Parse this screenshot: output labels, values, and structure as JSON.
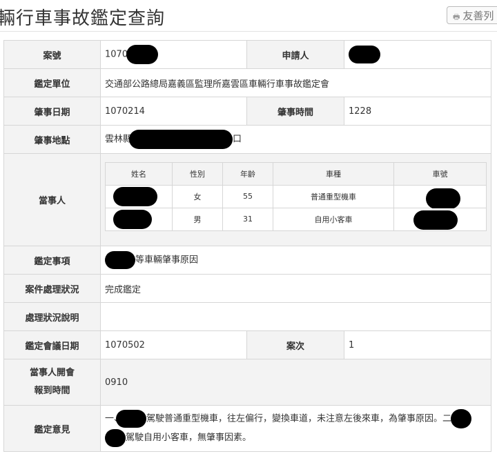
{
  "page_title": "輛行車事故鑑定查詢",
  "print_button": "友善列",
  "rows": {
    "case_no": {
      "label": "案號",
      "value_prefix": "1070"
    },
    "applicant": {
      "label": "申請人"
    },
    "unit": {
      "label": "鑑定單位",
      "value": "交通部公路總局嘉義區監理所嘉雲區車輛行車事故鑑定會"
    },
    "accident_date": {
      "label": "肇事日期",
      "value": "1070214"
    },
    "accident_time": {
      "label": "肇事時間",
      "value": "1228"
    },
    "location": {
      "label": "肇事地點",
      "value_prefix": "雲林縣",
      "value_suffix": "口"
    },
    "parties": {
      "label": "當事人"
    },
    "item": {
      "label": "鑑定事項",
      "value": "等車輛肇事原因"
    },
    "status": {
      "label": "案件處理狀況",
      "value": "完成鑑定"
    },
    "status_note": {
      "label": "處理狀況說明",
      "value": ""
    },
    "meeting_date": {
      "label": "鑑定會議日期",
      "value": "1070502"
    },
    "session": {
      "label": "案次",
      "value": "1"
    },
    "report_time": {
      "label_line1": "當事人開會",
      "label_line2": "報到時間",
      "value": "0910"
    },
    "opinion": {
      "label": "鑑定意見",
      "line1": "一、",
      "line1_text": "駕駛普通重型機車，往左偏行，變換車道，未注意左後來車，為肇事原因。二、",
      "line2_text": "駕駛自用小客車，無肇事因素。"
    }
  },
  "party_table": {
    "headers": [
      "姓名",
      "性別",
      "年齡",
      "車種",
      "車號"
    ],
    "rows": [
      {
        "gender": "女",
        "age": "55",
        "vehicle": "普通重型機車"
      },
      {
        "gender": "男",
        "age": "31",
        "vehicle": "自用小客車"
      }
    ]
  }
}
